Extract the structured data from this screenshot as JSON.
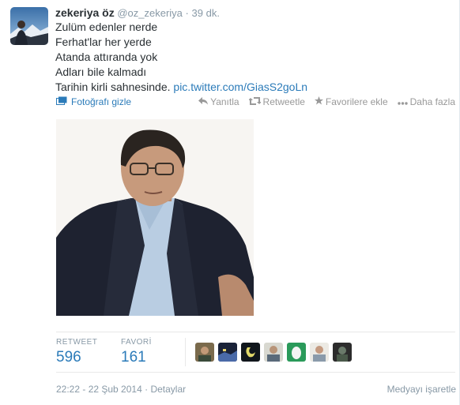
{
  "tweet": {
    "fullname": "zekeriya öz",
    "username": "@oz_zekeriya",
    "separator": "·",
    "time_ago": "39 dk.",
    "lines": [
      "Zulüm edenler nerde",
      "Ferhat'lar her yerde",
      "Atanda attıranda yok",
      "Adları bile kalmadı"
    ],
    "last_line_text": "Tarihin kirli sahnesinde. ",
    "link": "pic.twitter.com/GiasS2goLn",
    "photo_toggle": "Fotoğrafı gizle",
    "actions": {
      "reply": "Yanıtla",
      "retweet": "Retweetle",
      "favorite": "Favorilere ekle",
      "more": "Daha fazla"
    }
  },
  "stats": {
    "retweet_label": "RETWEET",
    "retweet_count": "596",
    "favorite_label": "FAVORİ",
    "favorite_count": "161"
  },
  "footer": {
    "timestamp": "22:22 - 22 Şub 2014",
    "sep": "·",
    "details": "Detaylar",
    "flag_media": "Medyayı işaretle"
  },
  "colors": {
    "link": "#2b7bb9",
    "muted": "#8899a6",
    "text": "#292f33"
  },
  "icons": [
    "reply-icon",
    "retweet-icon",
    "star-icon",
    "more-icon",
    "photo-icon"
  ]
}
